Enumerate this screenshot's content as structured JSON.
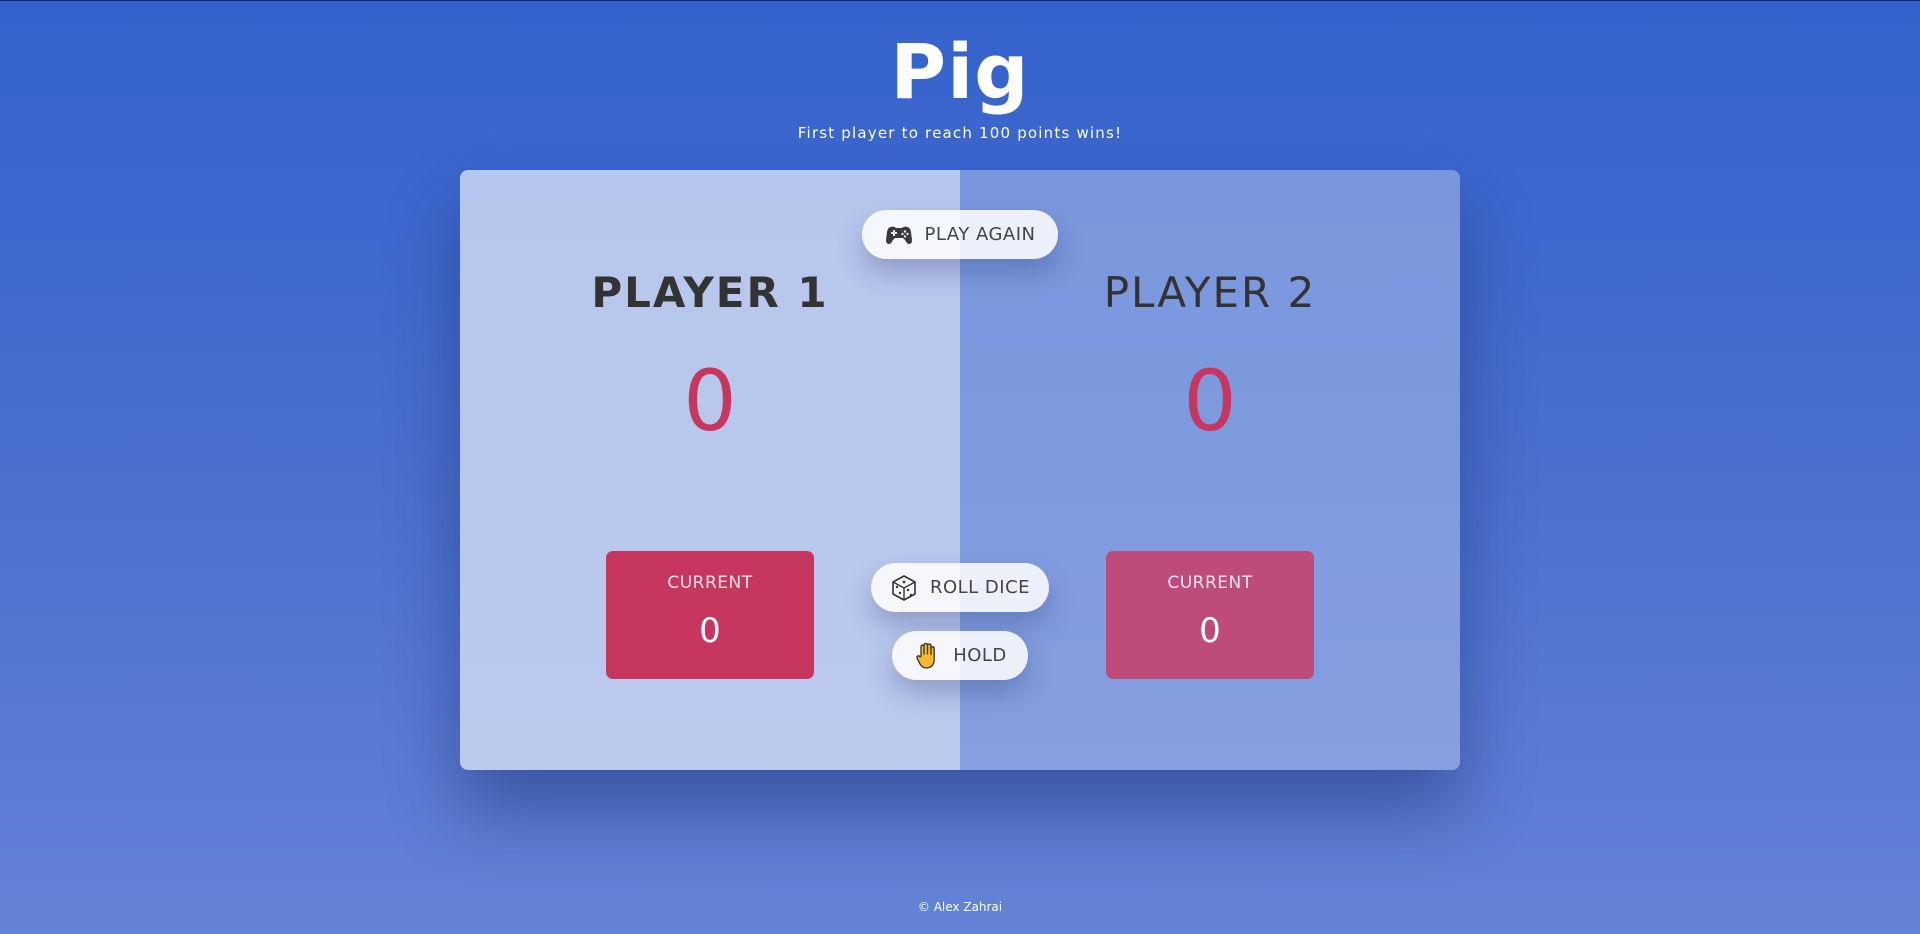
{
  "title": "Pig",
  "subtitle": "First player to reach 100 points wins!",
  "players": [
    {
      "name": "PLAYER 1",
      "score": "0",
      "current_label": "CURRENT",
      "current_score": "0",
      "active": true
    },
    {
      "name": "PLAYER 2",
      "score": "0",
      "current_label": "CURRENT",
      "current_score": "0",
      "active": false
    }
  ],
  "buttons": {
    "new_game": {
      "label": "PLAY AGAIN",
      "icon": "gamepad-icon"
    },
    "roll": {
      "label": "ROLL DICE",
      "icon": "dice-icon"
    },
    "hold": {
      "label": "HOLD",
      "icon": "raised-hand-icon"
    }
  },
  "footer": "© Alex Zahrai",
  "colors": {
    "accent": "#c7365f",
    "current_inactive": "#bd4c7a",
    "background_top": "#3462cc",
    "background_bottom": "#6383d6"
  }
}
